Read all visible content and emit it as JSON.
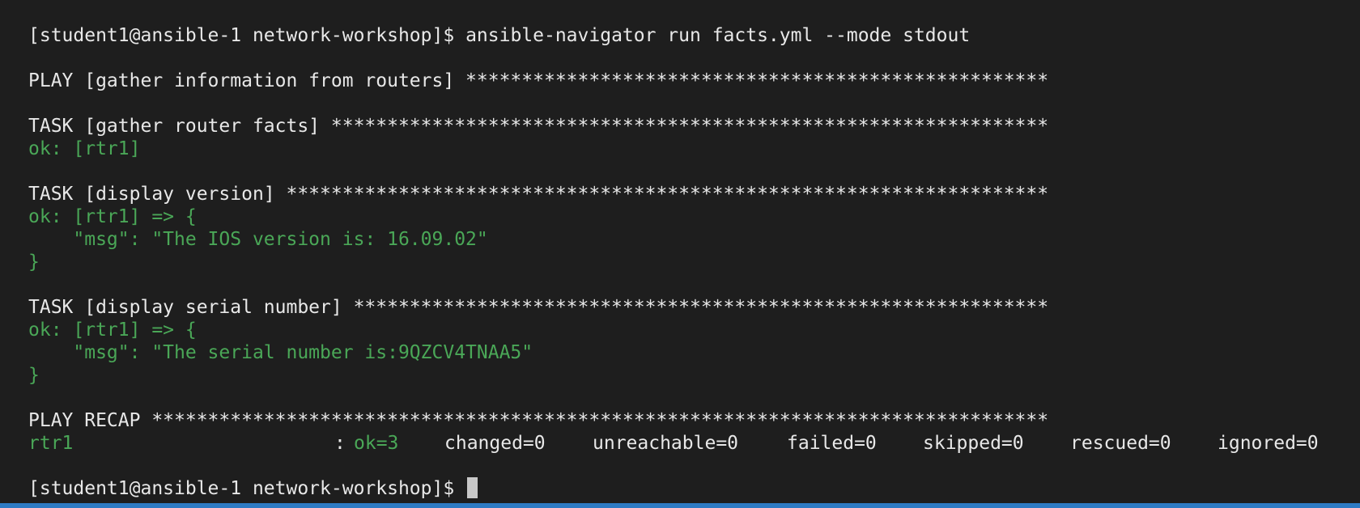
{
  "prompt": "[student1@ansible-1 network-workshop]$",
  "command": "ansible-navigator run facts.yml --mode stdout",
  "play_header": "PLAY [gather information from routers] ****************************************************",
  "task1_header": "TASK [gather router facts] ****************************************************************",
  "task1_result": "ok: [rtr1]",
  "task2_header": "TASK [display version] ********************************************************************",
  "task2_result_open": "ok: [rtr1] => {",
  "task2_msg": "    \"msg\": \"The IOS version is: 16.09.02\"",
  "task2_result_close": "}",
  "task3_header": "TASK [display serial number] **************************************************************",
  "task3_result_open": "ok: [rtr1] => {",
  "task3_msg": "    \"msg\": \"The serial number is:9QZCV4TNAA5\"",
  "task3_result_close": "}",
  "recap_header": "PLAY RECAP ********************************************************************************",
  "recap": {
    "host": "rtr1",
    "separator": ":",
    "ok": "ok=3",
    "changed": "changed=0",
    "unreachable": "unreachable=0",
    "failed": "failed=0",
    "skipped": "skipped=0",
    "rescued": "rescued=0",
    "ignored": "ignored=0"
  },
  "colors": {
    "background": "#1e1e1e",
    "text": "#e8e8e8",
    "ok_green": "#4aa757",
    "status_bar": "#2e7bc4"
  }
}
